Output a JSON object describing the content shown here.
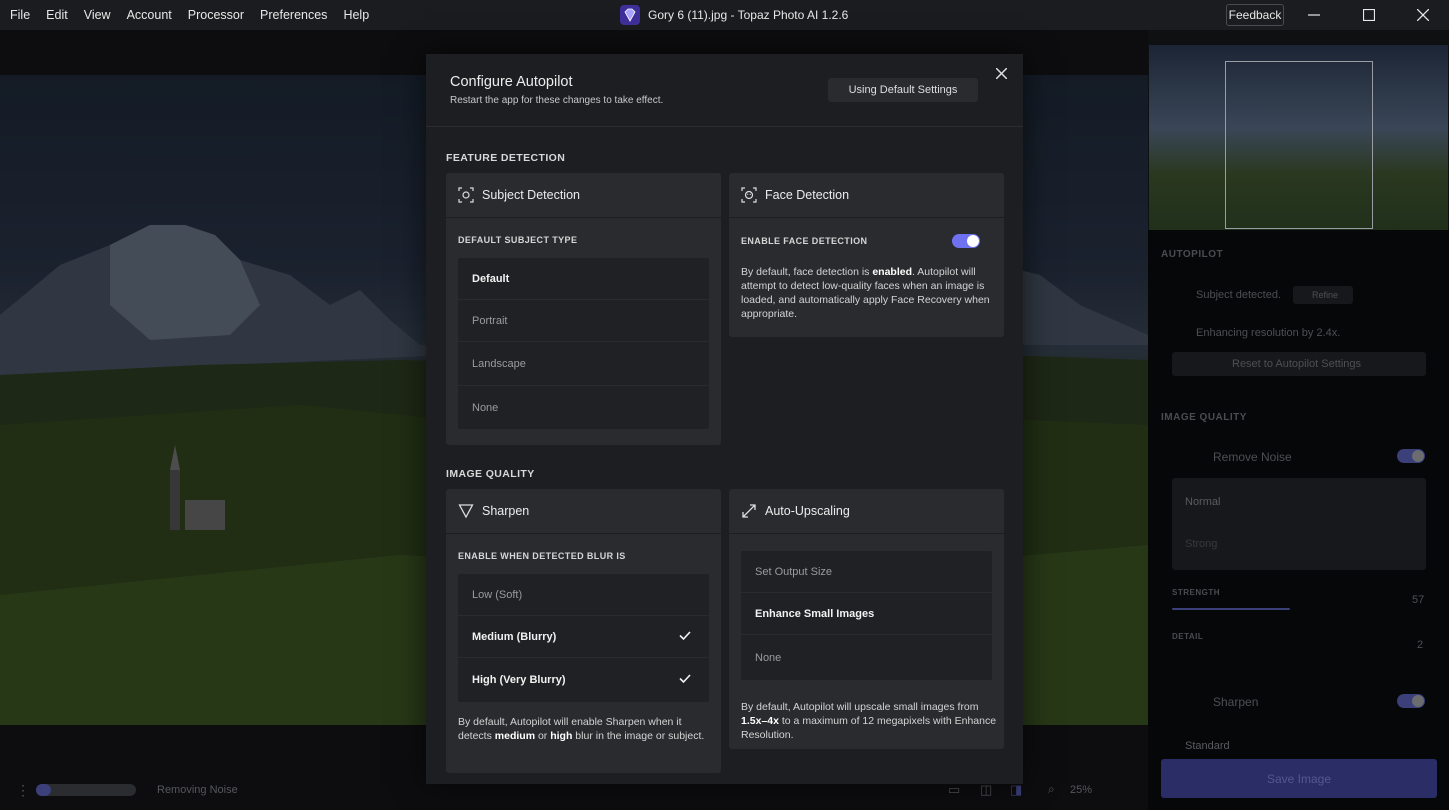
{
  "menu": [
    "File",
    "Edit",
    "View",
    "Account",
    "Processor",
    "Preferences",
    "Help"
  ],
  "window": {
    "title": "Gory 6 (11).jpg - Topaz Photo AI 1.2.6",
    "feedback": "Feedback"
  },
  "modal": {
    "title": "Configure Autopilot",
    "subtitle": "Restart the app for these changes to take effect.",
    "default_button": "Using Default Settings",
    "feature_section": "FEATURE DETECTION",
    "quality_section": "IMAGE QUALITY",
    "subject": {
      "title": "Subject Detection",
      "sub": "DEFAULT SUBJECT TYPE",
      "options": [
        "Default",
        "Portrait",
        "Landscape",
        "None"
      ]
    },
    "face": {
      "title": "Face Detection",
      "sub": "ENABLE FACE DETECTION",
      "enabled": true,
      "desc_1": "By default, face detection is ",
      "desc_bold": "enabled",
      "desc_2": ". Autopilot will attempt to detect low-quality faces when an image is loaded, and automatically apply Face Recovery when appropriate."
    },
    "sharpen": {
      "title": "Sharpen",
      "sub": "ENABLE WHEN DETECTED BLUR IS",
      "options": [
        "Low (Soft)",
        "Medium (Blurry)",
        "High (Very Blurry)"
      ],
      "desc_1": "By default, Autopilot will enable Sharpen when it detects ",
      "desc_b1": "medium",
      "desc_2": " or ",
      "desc_b2": "high",
      "desc_3": " blur in the image or subject."
    },
    "upscale": {
      "title": "Auto-Upscaling",
      "options": [
        "Set Output Size",
        "Enhance Small Images",
        "None"
      ],
      "desc_1": "By default, Autopilot will upscale small images from ",
      "desc_b1": "1.5x–4x",
      "desc_2": " to a maximum of 12 megapixels with Enhance Resolution."
    }
  },
  "right_panel": {
    "autopilot": "AUTOPILOT",
    "subject_detected": "Subject detected.",
    "refine": "Refine",
    "enhancing": "Enhancing resolution by 2.4x.",
    "reset": "Reset to Autopilot Settings",
    "image_quality": "IMAGE QUALITY",
    "remove_noise": "Remove Noise",
    "normal": "Normal",
    "strong": "Strong",
    "strength_label": "STRENGTH",
    "strength_value": "57",
    "detail_label": "DETAIL",
    "detail_value": "2",
    "sharpen": "Sharpen",
    "standard": "Standard",
    "save": "Save Image"
  },
  "bottom": {
    "status": "Removing Noise",
    "zoom": "25%",
    "progress": 0.15
  },
  "colors": {
    "accent": "#6e72f0",
    "panel": "#2a2b2f",
    "modal": "#1d1e21"
  }
}
